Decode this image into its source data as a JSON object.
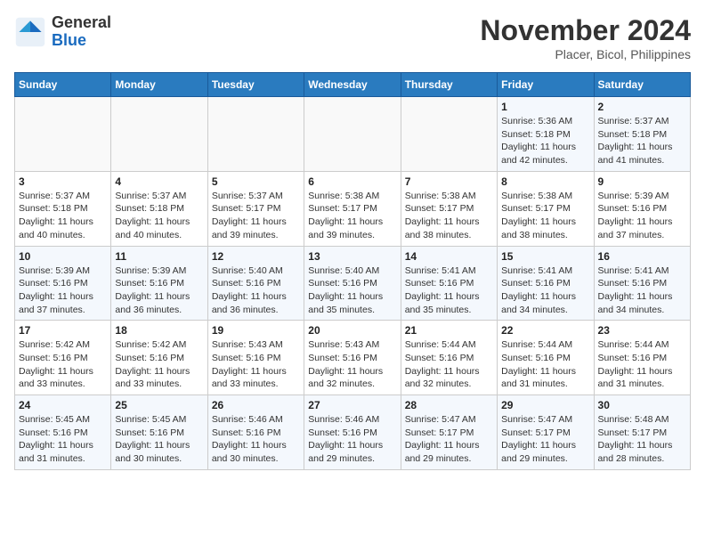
{
  "header": {
    "logo_general": "General",
    "logo_blue": "Blue",
    "month": "November 2024",
    "location": "Placer, Bicol, Philippines"
  },
  "days_of_week": [
    "Sunday",
    "Monday",
    "Tuesday",
    "Wednesday",
    "Thursday",
    "Friday",
    "Saturday"
  ],
  "weeks": [
    [
      {
        "day": "",
        "info": ""
      },
      {
        "day": "",
        "info": ""
      },
      {
        "day": "",
        "info": ""
      },
      {
        "day": "",
        "info": ""
      },
      {
        "day": "",
        "info": ""
      },
      {
        "day": "1",
        "info": "Sunrise: 5:36 AM\nSunset: 5:18 PM\nDaylight: 11 hours and 42 minutes."
      },
      {
        "day": "2",
        "info": "Sunrise: 5:37 AM\nSunset: 5:18 PM\nDaylight: 11 hours and 41 minutes."
      }
    ],
    [
      {
        "day": "3",
        "info": "Sunrise: 5:37 AM\nSunset: 5:18 PM\nDaylight: 11 hours and 40 minutes."
      },
      {
        "day": "4",
        "info": "Sunrise: 5:37 AM\nSunset: 5:18 PM\nDaylight: 11 hours and 40 minutes."
      },
      {
        "day": "5",
        "info": "Sunrise: 5:37 AM\nSunset: 5:17 PM\nDaylight: 11 hours and 39 minutes."
      },
      {
        "day": "6",
        "info": "Sunrise: 5:38 AM\nSunset: 5:17 PM\nDaylight: 11 hours and 39 minutes."
      },
      {
        "day": "7",
        "info": "Sunrise: 5:38 AM\nSunset: 5:17 PM\nDaylight: 11 hours and 38 minutes."
      },
      {
        "day": "8",
        "info": "Sunrise: 5:38 AM\nSunset: 5:17 PM\nDaylight: 11 hours and 38 minutes."
      },
      {
        "day": "9",
        "info": "Sunrise: 5:39 AM\nSunset: 5:16 PM\nDaylight: 11 hours and 37 minutes."
      }
    ],
    [
      {
        "day": "10",
        "info": "Sunrise: 5:39 AM\nSunset: 5:16 PM\nDaylight: 11 hours and 37 minutes."
      },
      {
        "day": "11",
        "info": "Sunrise: 5:39 AM\nSunset: 5:16 PM\nDaylight: 11 hours and 36 minutes."
      },
      {
        "day": "12",
        "info": "Sunrise: 5:40 AM\nSunset: 5:16 PM\nDaylight: 11 hours and 36 minutes."
      },
      {
        "day": "13",
        "info": "Sunrise: 5:40 AM\nSunset: 5:16 PM\nDaylight: 11 hours and 35 minutes."
      },
      {
        "day": "14",
        "info": "Sunrise: 5:41 AM\nSunset: 5:16 PM\nDaylight: 11 hours and 35 minutes."
      },
      {
        "day": "15",
        "info": "Sunrise: 5:41 AM\nSunset: 5:16 PM\nDaylight: 11 hours and 34 minutes."
      },
      {
        "day": "16",
        "info": "Sunrise: 5:41 AM\nSunset: 5:16 PM\nDaylight: 11 hours and 34 minutes."
      }
    ],
    [
      {
        "day": "17",
        "info": "Sunrise: 5:42 AM\nSunset: 5:16 PM\nDaylight: 11 hours and 33 minutes."
      },
      {
        "day": "18",
        "info": "Sunrise: 5:42 AM\nSunset: 5:16 PM\nDaylight: 11 hours and 33 minutes."
      },
      {
        "day": "19",
        "info": "Sunrise: 5:43 AM\nSunset: 5:16 PM\nDaylight: 11 hours and 33 minutes."
      },
      {
        "day": "20",
        "info": "Sunrise: 5:43 AM\nSunset: 5:16 PM\nDaylight: 11 hours and 32 minutes."
      },
      {
        "day": "21",
        "info": "Sunrise: 5:44 AM\nSunset: 5:16 PM\nDaylight: 11 hours and 32 minutes."
      },
      {
        "day": "22",
        "info": "Sunrise: 5:44 AM\nSunset: 5:16 PM\nDaylight: 11 hours and 31 minutes."
      },
      {
        "day": "23",
        "info": "Sunrise: 5:44 AM\nSunset: 5:16 PM\nDaylight: 11 hours and 31 minutes."
      }
    ],
    [
      {
        "day": "24",
        "info": "Sunrise: 5:45 AM\nSunset: 5:16 PM\nDaylight: 11 hours and 31 minutes."
      },
      {
        "day": "25",
        "info": "Sunrise: 5:45 AM\nSunset: 5:16 PM\nDaylight: 11 hours and 30 minutes."
      },
      {
        "day": "26",
        "info": "Sunrise: 5:46 AM\nSunset: 5:16 PM\nDaylight: 11 hours and 30 minutes."
      },
      {
        "day": "27",
        "info": "Sunrise: 5:46 AM\nSunset: 5:16 PM\nDaylight: 11 hours and 29 minutes."
      },
      {
        "day": "28",
        "info": "Sunrise: 5:47 AM\nSunset: 5:17 PM\nDaylight: 11 hours and 29 minutes."
      },
      {
        "day": "29",
        "info": "Sunrise: 5:47 AM\nSunset: 5:17 PM\nDaylight: 11 hours and 29 minutes."
      },
      {
        "day": "30",
        "info": "Sunrise: 5:48 AM\nSunset: 5:17 PM\nDaylight: 11 hours and 28 minutes."
      }
    ]
  ]
}
